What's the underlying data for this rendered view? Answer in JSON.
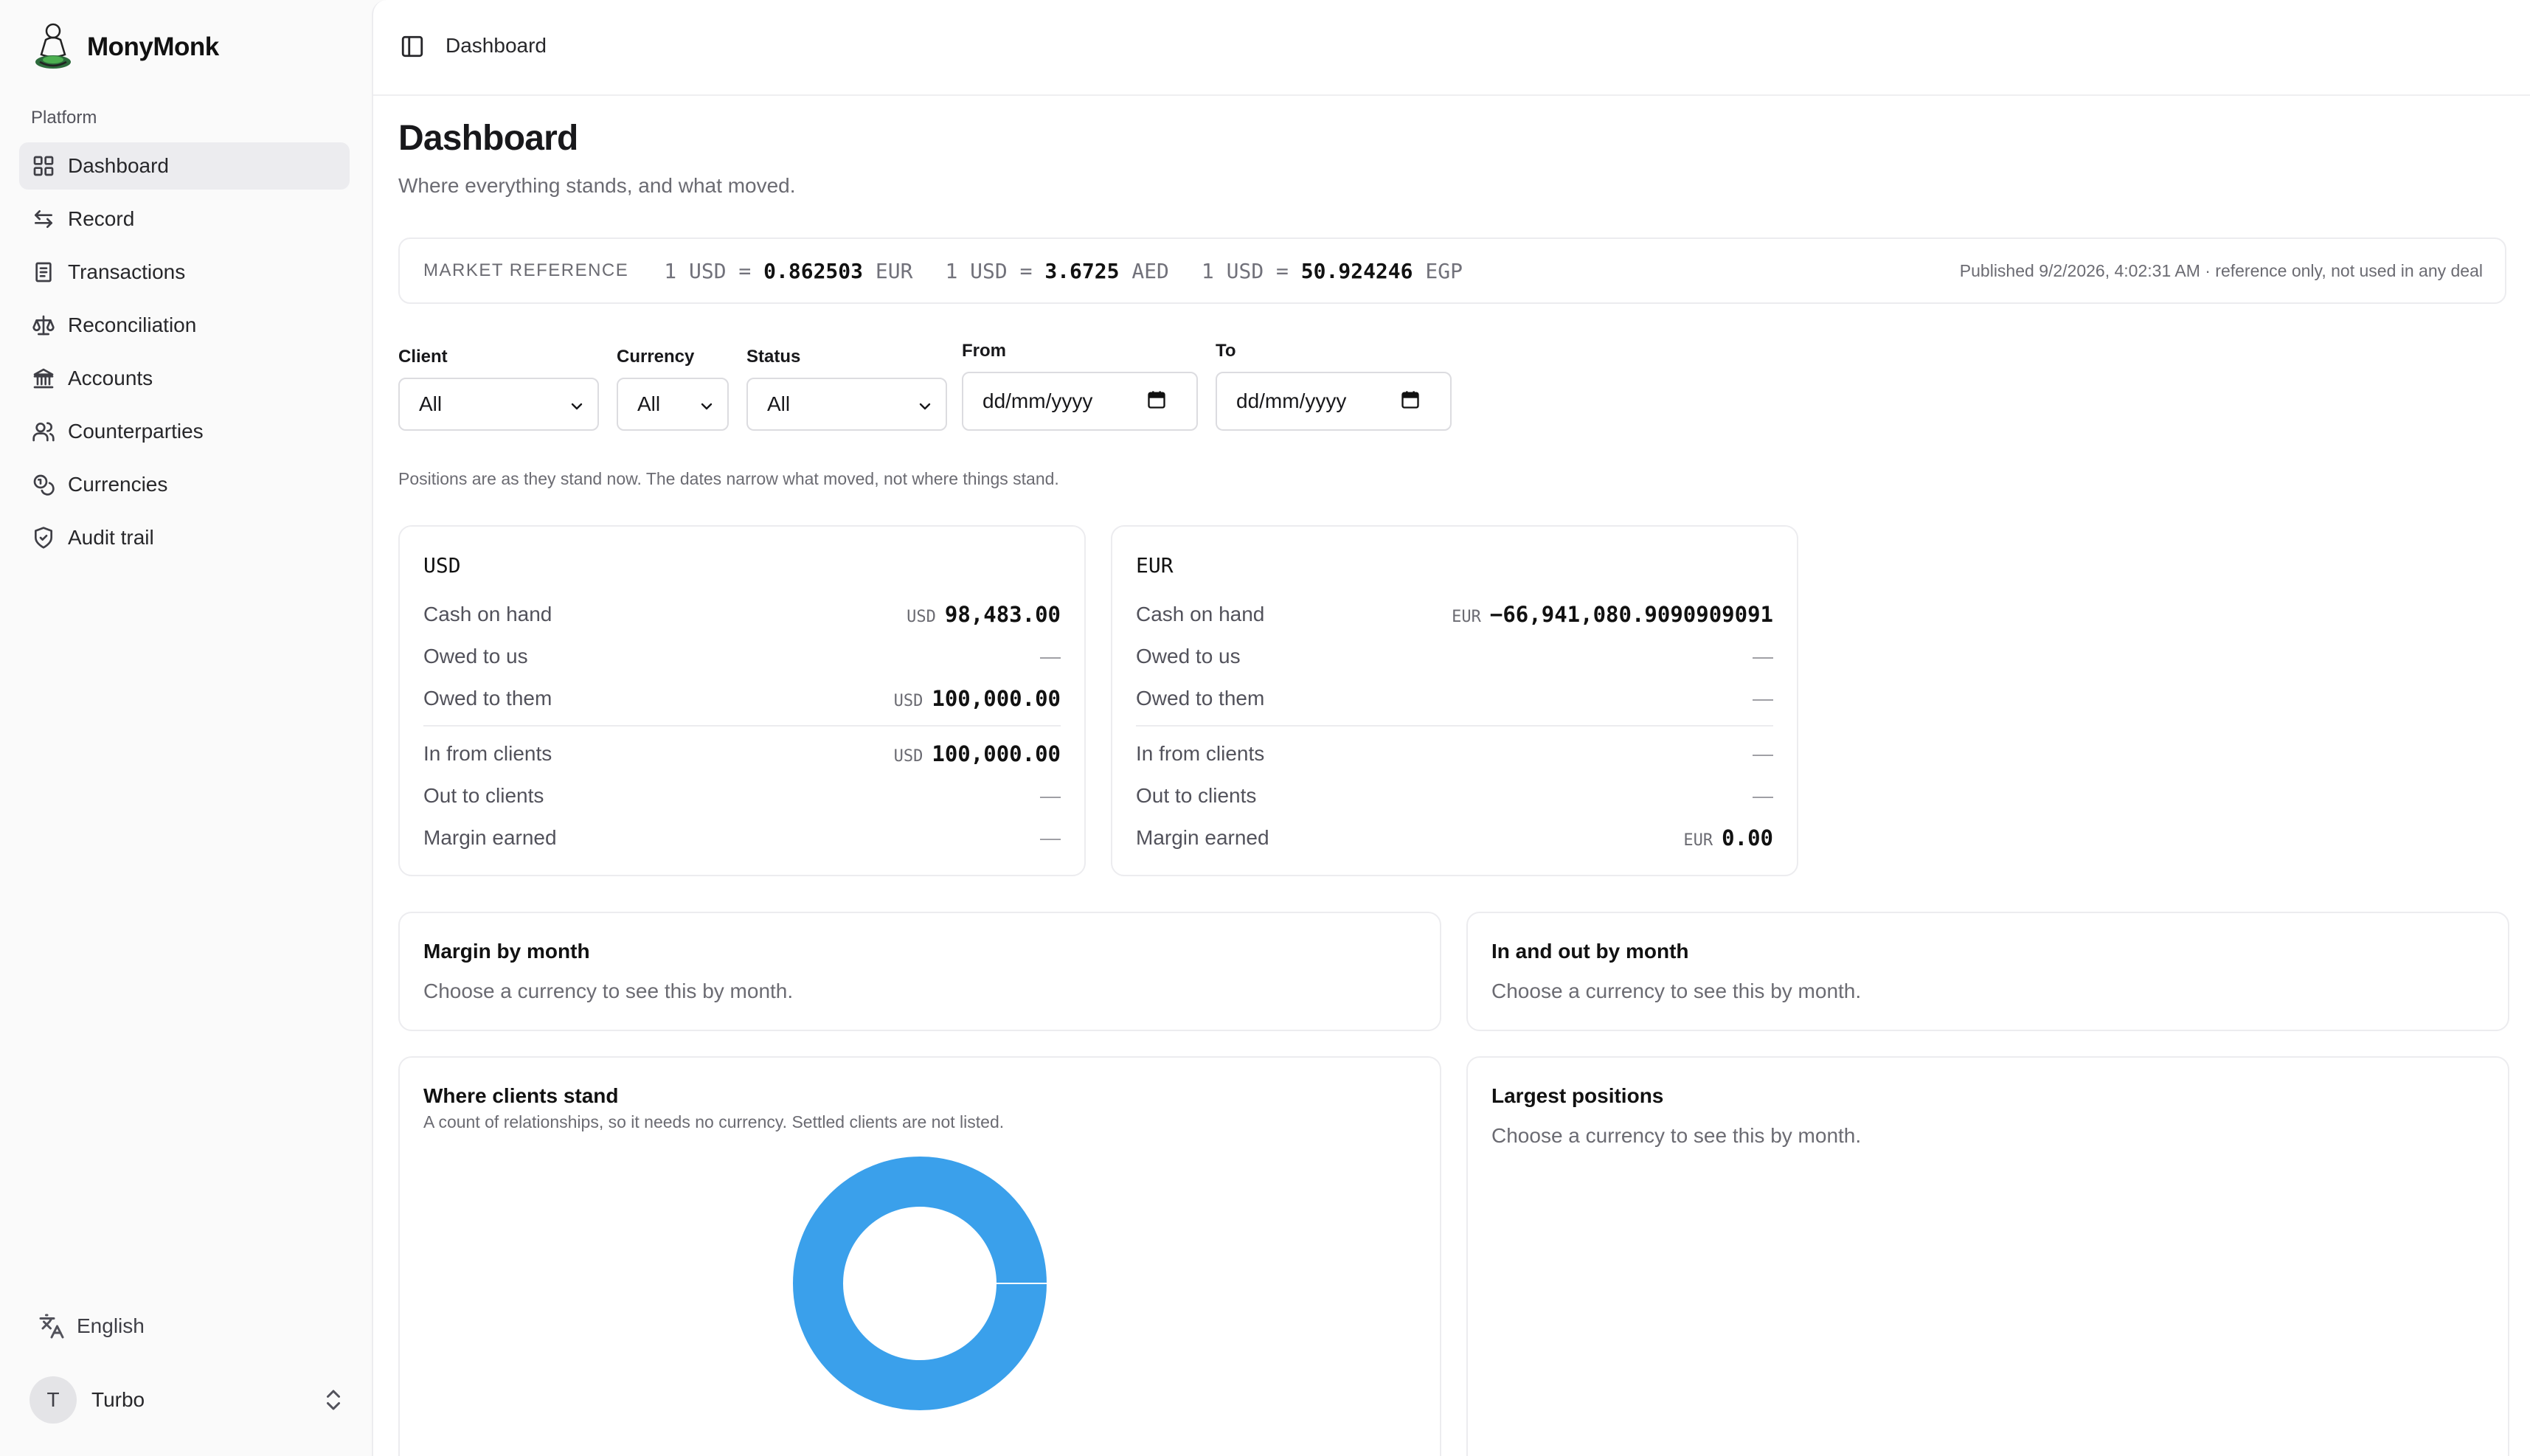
{
  "brand": {
    "name": "MonyMonk"
  },
  "sidebar": {
    "group_label": "Platform",
    "items": [
      {
        "label": "Dashboard",
        "icon": "layout-grid-icon",
        "active": true
      },
      {
        "label": "Record",
        "icon": "arrows-left-right-icon"
      },
      {
        "label": "Transactions",
        "icon": "receipt-icon"
      },
      {
        "label": "Reconciliation",
        "icon": "scale-icon"
      },
      {
        "label": "Accounts",
        "icon": "landmark-icon"
      },
      {
        "label": "Counterparties",
        "icon": "users-icon"
      },
      {
        "label": "Currencies",
        "icon": "coins-icon"
      },
      {
        "label": "Audit trail",
        "icon": "shield-check-icon"
      }
    ],
    "language": "English",
    "user": {
      "initial": "T",
      "name": "Turbo"
    }
  },
  "header": {
    "breadcrumb": "Dashboard"
  },
  "page": {
    "title": "Dashboard",
    "subtitle": "Where everything stands, and what moved."
  },
  "market": {
    "label": "MARKET REFERENCE",
    "rates": [
      {
        "base": "1 USD =",
        "value": "0.862503",
        "quote": "EUR"
      },
      {
        "base": "1 USD =",
        "value": "3.6725",
        "quote": "AED"
      },
      {
        "base": "1 USD =",
        "value": "50.924246",
        "quote": "EGP"
      }
    ],
    "published": "Published 9/2/2026, 4:02:31 AM · reference only, not used in any deal"
  },
  "filters": {
    "client": {
      "label": "Client",
      "value": "All"
    },
    "currency": {
      "label": "Currency",
      "value": "All"
    },
    "status": {
      "label": "Status",
      "value": "All"
    },
    "from": {
      "label": "From",
      "placeholder": "dd/mm/yyyy"
    },
    "to": {
      "label": "To",
      "placeholder": "dd/mm/yyyy"
    }
  },
  "positions_note": "Positions are as they stand now. The dates narrow what moved, not where things stand.",
  "currency_cards": [
    {
      "code": "USD",
      "rows": [
        {
          "label": "Cash on hand",
          "cc": "USD",
          "value": "98,483.00"
        },
        {
          "label": "Owed to us",
          "value": "—"
        },
        {
          "label": "Owed to them",
          "cc": "USD",
          "value": "100,000.00"
        },
        {
          "label": "In from clients",
          "cc": "USD",
          "value": "100,000.00"
        },
        {
          "label": "Out to clients",
          "value": "—"
        },
        {
          "label": "Margin earned",
          "value": "—"
        }
      ]
    },
    {
      "code": "EUR",
      "rows": [
        {
          "label": "Cash on hand",
          "cc": "EUR",
          "value": "−66,941,080.9090909091"
        },
        {
          "label": "Owed to us",
          "value": "—"
        },
        {
          "label": "Owed to them",
          "value": "—"
        },
        {
          "label": "In from clients",
          "value": "—"
        },
        {
          "label": "Out to clients",
          "value": "—"
        },
        {
          "label": "Margin earned",
          "cc": "EUR",
          "value": "0.00"
        }
      ]
    }
  ],
  "panels": {
    "margin_by_month": {
      "title": "Margin by month",
      "message": "Choose a currency to see this by month."
    },
    "in_out_by_month": {
      "title": "In and out by month",
      "message": "Choose a currency to see this by month."
    },
    "clients": {
      "title": "Where clients stand",
      "subtitle": "A count of relationships, so it needs no currency. Settled clients are not listed."
    },
    "largest": {
      "title": "Largest positions",
      "message": "Choose a currency to see this by month."
    }
  },
  "chart_data": {
    "type": "pie",
    "style": "donut",
    "values": [
      1
    ],
    "colors": [
      "#3aa0eb"
    ]
  }
}
